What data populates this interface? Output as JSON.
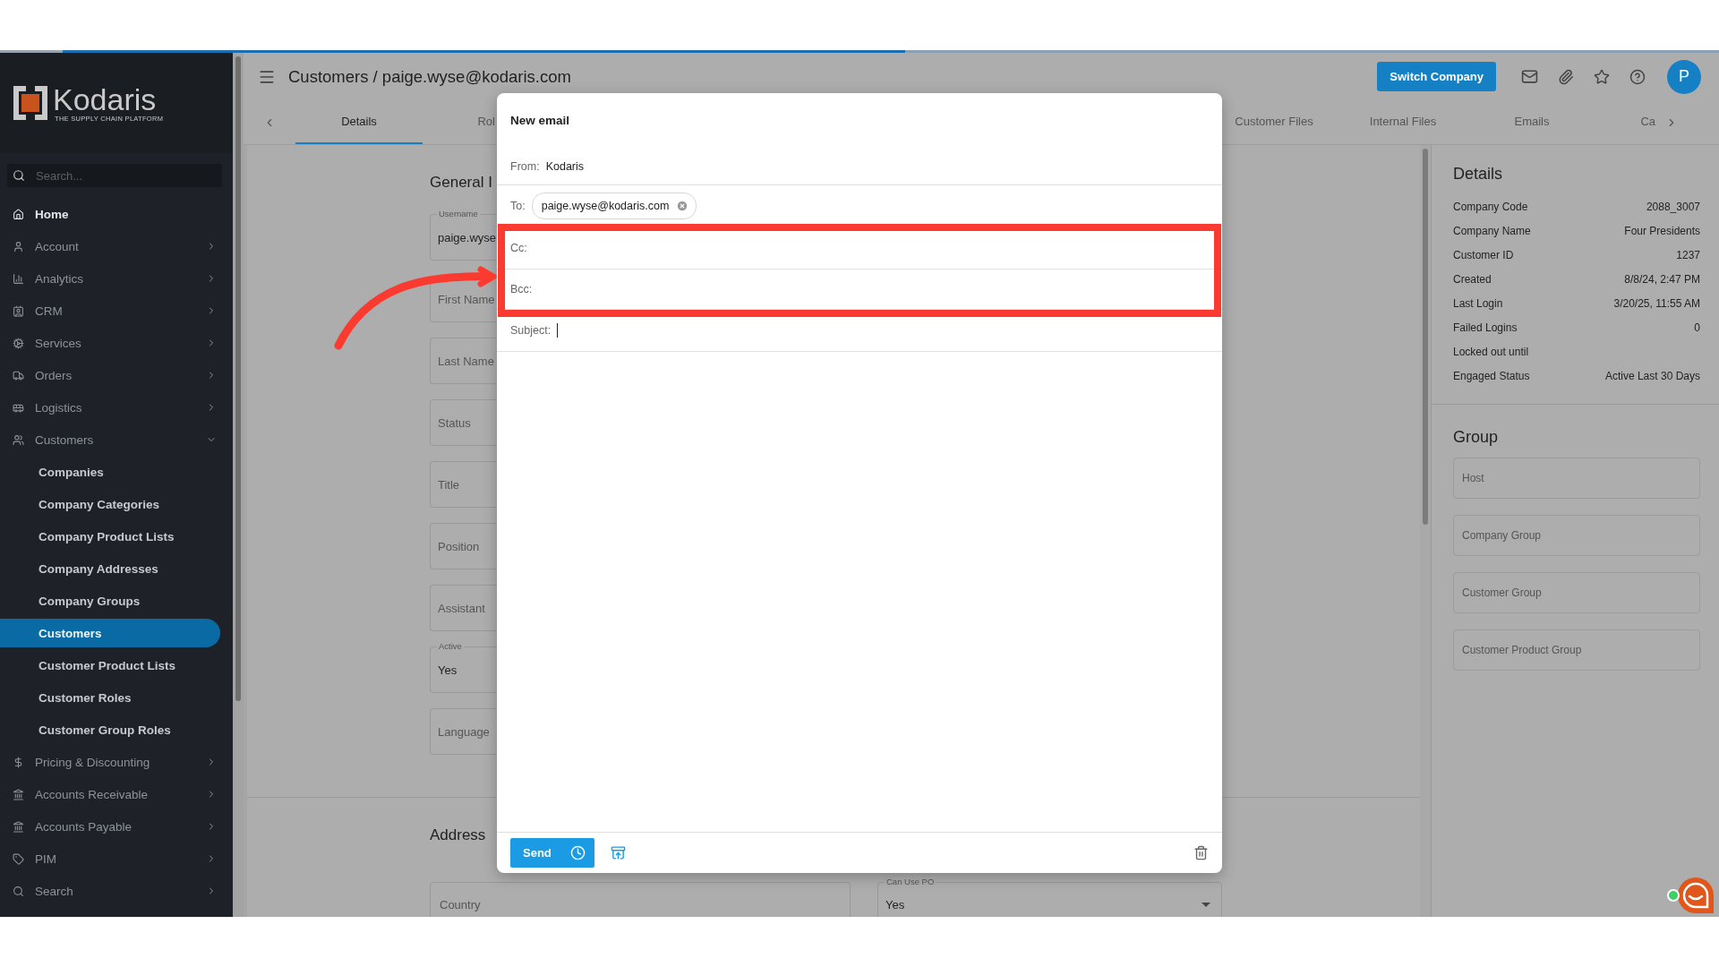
{
  "brand": {
    "name": "Kodaris",
    "tagline": "THE SUPPLY CHAIN PLATFORM"
  },
  "sidebar": {
    "search": {
      "placeholder": "Search..."
    },
    "items": [
      {
        "label": "Home",
        "expandable": false,
        "expanded": false
      },
      {
        "label": "Account",
        "expandable": true,
        "expanded": false
      },
      {
        "label": "Analytics",
        "expandable": true,
        "expanded": false
      },
      {
        "label": "CRM",
        "expandable": true,
        "expanded": false
      },
      {
        "label": "Services",
        "expandable": true,
        "expanded": false
      },
      {
        "label": "Orders",
        "expandable": true,
        "expanded": false
      },
      {
        "label": "Logistics",
        "expandable": true,
        "expanded": false
      },
      {
        "label": "Customers",
        "expandable": true,
        "expanded": true,
        "children": [
          {
            "label": "Companies",
            "selected": false
          },
          {
            "label": "Company Categories",
            "selected": false
          },
          {
            "label": "Company Product Lists",
            "selected": false
          },
          {
            "label": "Company Addresses",
            "selected": false
          },
          {
            "label": "Company Groups",
            "selected": false
          },
          {
            "label": "Customers",
            "selected": true
          },
          {
            "label": "Customer Product Lists",
            "selected": false
          },
          {
            "label": "Customer Roles",
            "selected": false
          },
          {
            "label": "Customer Group Roles",
            "selected": false
          }
        ]
      },
      {
        "label": "Pricing & Discounting",
        "expandable": true,
        "expanded": false
      },
      {
        "label": "Accounts Receivable",
        "expandable": true,
        "expanded": false
      },
      {
        "label": "Accounts Payable",
        "expandable": true,
        "expanded": false
      },
      {
        "label": "PIM",
        "expandable": true,
        "expanded": false
      },
      {
        "label": "Search",
        "expandable": true,
        "expanded": false
      }
    ]
  },
  "header": {
    "title": "Customers / paige.wyse@kodaris.com",
    "switch_button": "Switch Company",
    "avatar": "P"
  },
  "tabs_left": [
    {
      "label": "Details",
      "selected": true
    },
    {
      "label": "Rol",
      "selected": false
    }
  ],
  "tabs_right": [
    {
      "label": "Customer Files",
      "selected": false
    },
    {
      "label": "Internal Files",
      "selected": false
    },
    {
      "label": "Emails",
      "selected": false
    },
    {
      "label": "Ca",
      "selected": false
    }
  ],
  "general": {
    "title": "General I",
    "fields": [
      {
        "legend": "Username",
        "value": "paige.wyse"
      },
      {
        "placeholder": "First Name"
      },
      {
        "placeholder": "Last Name"
      },
      {
        "placeholder": "Status"
      },
      {
        "placeholder": "Title"
      },
      {
        "placeholder": "Position"
      },
      {
        "placeholder": "Assistant"
      },
      {
        "legend": "Active",
        "value": "Yes"
      },
      {
        "placeholder": "Language"
      }
    ]
  },
  "address": {
    "title": "Address",
    "country": {
      "placeholder": "Country"
    },
    "can_use_po": {
      "legend": "Can Use PO",
      "value": "Yes"
    }
  },
  "details": {
    "title": "Details",
    "rows": [
      {
        "label": "Company Code",
        "value": "2088_3007"
      },
      {
        "label": "Company Name",
        "value": "Four Presidents"
      },
      {
        "label": "Customer ID",
        "value": "1237"
      },
      {
        "label": "Created",
        "value": "8/8/24, 2:47 PM"
      },
      {
        "label": "Last Login",
        "value": "3/20/25, 11:55 AM"
      },
      {
        "label": "Failed Logins",
        "value": "0"
      },
      {
        "label": "Locked out until"
      },
      {
        "label": "Engaged Status",
        "value": "Active Last 30 Days"
      }
    ]
  },
  "group": {
    "title": "Group",
    "fields": [
      {
        "placeholder": "Host"
      },
      {
        "placeholder": "Company Group"
      },
      {
        "placeholder": "Customer Group"
      },
      {
        "placeholder": "Customer Product Group"
      }
    ]
  },
  "email_dialog": {
    "title": "New email",
    "from_label": "From:",
    "from_value": "Kodaris",
    "to_label": "To:",
    "recipients": [
      "paige.wyse@kodaris.com"
    ],
    "cc_label": "Cc:",
    "bcc_label": "Bcc:",
    "subject_label": "Subject:",
    "send": "Send"
  }
}
